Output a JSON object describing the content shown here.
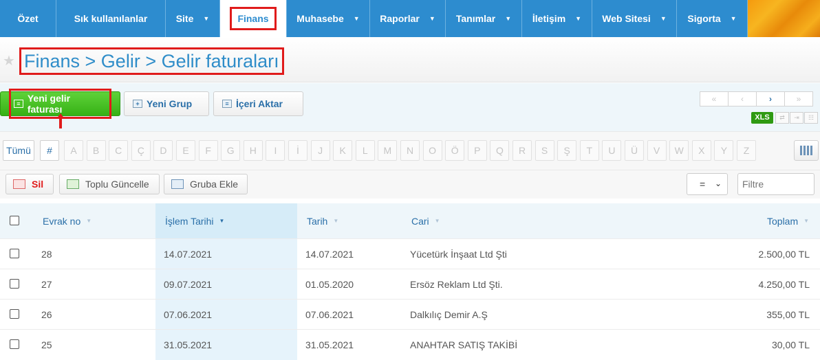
{
  "nav": {
    "items": [
      {
        "label": "Özet",
        "caret": false,
        "active": false
      },
      {
        "label": "Sık kullanılanlar",
        "caret": false,
        "active": false
      },
      {
        "label": "Site",
        "caret": true,
        "active": false
      },
      {
        "label": "Finans",
        "caret": false,
        "active": true
      },
      {
        "label": "Muhasebe",
        "caret": true,
        "active": false
      },
      {
        "label": "Raporlar",
        "caret": true,
        "active": false
      },
      {
        "label": "Tanımlar",
        "caret": true,
        "active": false
      },
      {
        "label": "İletişim",
        "caret": true,
        "active": false
      },
      {
        "label": "Web Sitesi",
        "caret": true,
        "active": false
      },
      {
        "label": "Sigorta",
        "caret": true,
        "active": false
      }
    ],
    "accent": "#2d8ccf"
  },
  "page": {
    "title": "Finans > Gelir > Gelir faturaları"
  },
  "toolbar": {
    "new_invoice": "Yeni gelir faturası",
    "new_group": "Yeni Grup",
    "import": "İçeri Aktar",
    "pager": [
      "«",
      "‹",
      "›",
      "»"
    ],
    "xls": "XLS"
  },
  "alpha": {
    "all": "Tümü",
    "hash": "#",
    "letters": [
      "A",
      "B",
      "C",
      "Ç",
      "D",
      "E",
      "F",
      "G",
      "H",
      "I",
      "İ",
      "J",
      "K",
      "L",
      "M",
      "N",
      "O",
      "Ö",
      "P",
      "Q",
      "R",
      "S",
      "Ş",
      "T",
      "U",
      "Ü",
      "V",
      "W",
      "X",
      "Y",
      "Z"
    ]
  },
  "actions": {
    "delete": "Sil",
    "bulk_update": "Toplu Güncelle",
    "add_to_group": "Gruba Ekle",
    "operator": "=",
    "filter_placeholder": "Filtre"
  },
  "table": {
    "columns": [
      "Evrak no",
      "İşlem Tarihi",
      "Tarih",
      "Cari",
      "Toplam"
    ],
    "rows": [
      [
        "28",
        "14.07.2021",
        "14.07.2021",
        "Yücetürk İnşaat Ltd Şti",
        "2.500,00 TL"
      ],
      [
        "27",
        "09.07.2021",
        "01.05.2020",
        "Ersöz Reklam Ltd Şti.",
        "4.250,00 TL"
      ],
      [
        "26",
        "07.06.2021",
        "07.06.2021",
        "Dalkılıç Demir A.Ş",
        "355,00 TL"
      ],
      [
        "25",
        "31.05.2021",
        "31.05.2021",
        "ANAHTAR SATIŞ TAKİBİ",
        "30,00 TL"
      ]
    ]
  }
}
